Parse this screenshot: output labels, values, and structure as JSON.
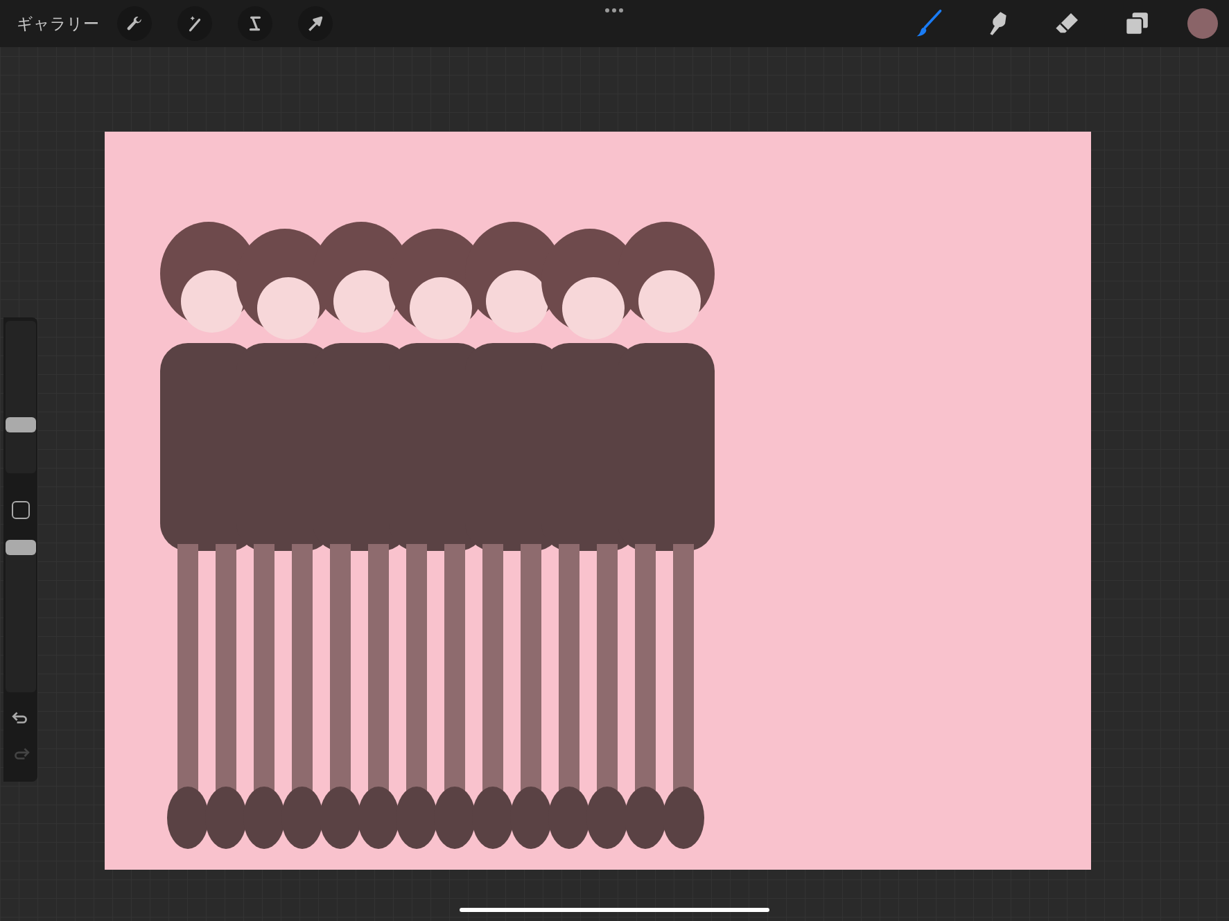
{
  "toolbar": {
    "gallery_label": "ギャラリー",
    "actions": [
      {
        "kind": "wrench"
      },
      {
        "kind": "wand"
      },
      {
        "kind": "selection"
      },
      {
        "kind": "transform"
      }
    ],
    "tools": [
      {
        "kind": "brush",
        "selected": true
      },
      {
        "kind": "smudge",
        "selected": false
      },
      {
        "kind": "eraser",
        "selected": false
      },
      {
        "kind": "layers",
        "selected": false
      }
    ],
    "color_swatch": {
      "color": "#8a6468"
    }
  },
  "sidebar": {
    "brush_size": {
      "level": 0.3
    },
    "opacity": {
      "level": 1
    },
    "undo": {
      "disabled": false
    },
    "redo": {
      "disabled": true
    }
  }
}
